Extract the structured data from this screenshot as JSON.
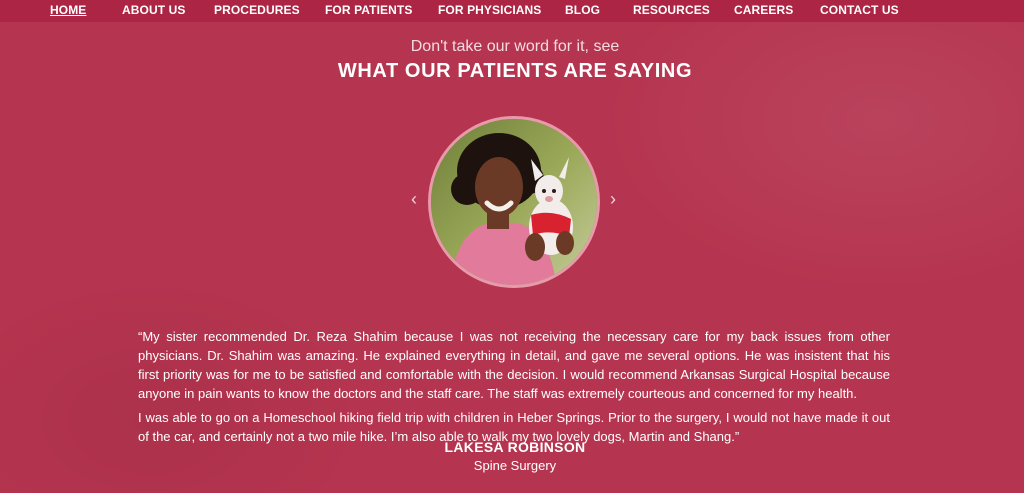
{
  "nav": {
    "items": [
      {
        "label": "HOME"
      },
      {
        "label": "ABOUT US"
      },
      {
        "label": "PROCEDURES"
      },
      {
        "label": "FOR PATIENTS"
      },
      {
        "label": "FOR PHYSICIANS"
      },
      {
        "label": "BLOG"
      },
      {
        "label": "RESOURCES"
      },
      {
        "label": "CAREERS"
      },
      {
        "label": "CONTACT US"
      }
    ],
    "active": "HOME"
  },
  "testimonials": {
    "eyebrow": "Don't take our word for it, see",
    "headline": "WHAT OUR PATIENTS ARE SAYING",
    "prev_icon": "chevron-left-icon",
    "next_icon": "chevron-right-icon",
    "quote_p1": "“My sister recommended Dr. Reza Shahim because I was not receiving the necessary care for my back issues from other physicians. Dr. Shahim was amazing. He explained everything in detail, and gave me several options. He was insistent that his first priority was for me to be satisfied and comfortable with the decision. I would recommend Arkansas Surgical Hospital because anyone in pain wants to know the doctors and the staff care. The staff was extremely courteous and concerned for my health.",
    "quote_p2": "I was able to go on a Homeschool hiking field trip with children in Heber Springs. Prior to the surgery, I would not have made it out of the car, and certainly not a two mile hike. I’m also able to walk my two lovely dogs, Martin and Shang.”",
    "patient_name": "LAKESA ROBINSON",
    "procedure": "Spine Surgery"
  },
  "colors": {
    "background": "#b5344f",
    "nav_bar": "#ad2544",
    "photo_ring": "#e69aaa"
  }
}
